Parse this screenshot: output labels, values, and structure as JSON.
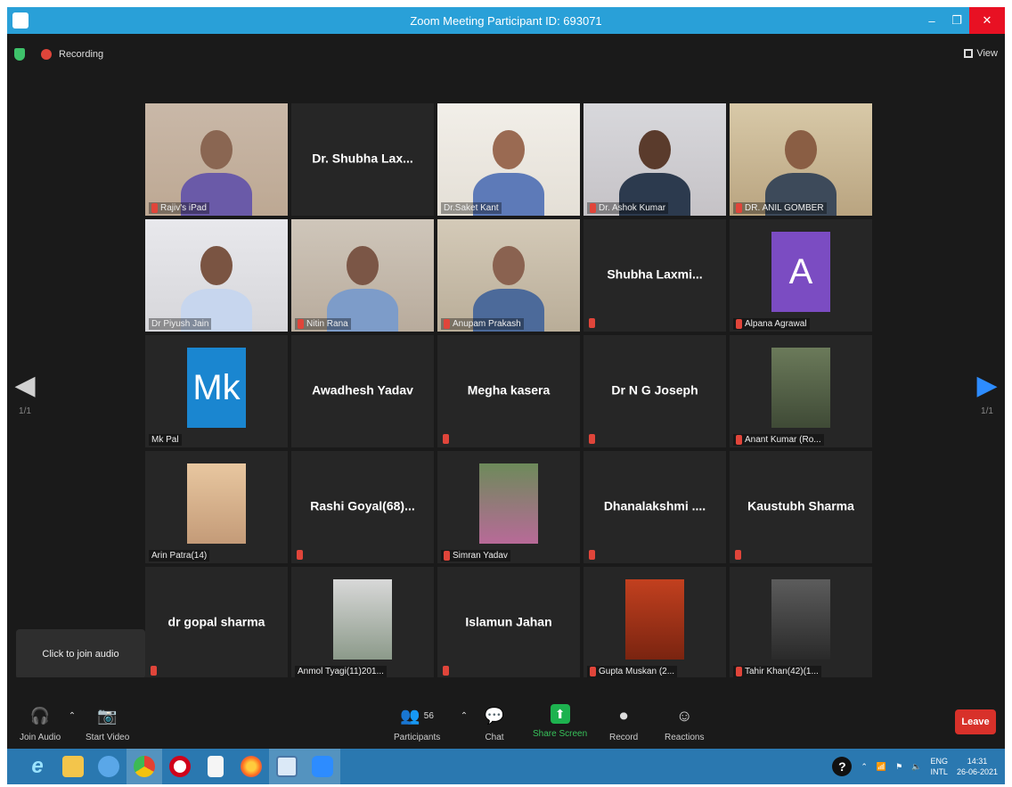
{
  "window": {
    "title": "Zoom Meeting Participant ID: 693071",
    "minimize": "–",
    "restore": "❐",
    "close": "✕"
  },
  "status": {
    "recording": "Recording",
    "view": "View"
  },
  "pager": {
    "left": "1/1",
    "right": "1/1"
  },
  "tiles": [
    {
      "name": "Rajiv's iPad",
      "type": "video",
      "muted": true,
      "active": false
    },
    {
      "name": "Dr. Shubha Lax...",
      "type": "name",
      "muted": false,
      "active": false
    },
    {
      "name": "Dr.Saket Kant",
      "type": "video",
      "muted": false,
      "active": false
    },
    {
      "name": "Dr. Ashok Kumar",
      "type": "video",
      "muted": true,
      "active": false
    },
    {
      "name": "DR. ANIL GOMBER",
      "type": "video",
      "muted": true,
      "active": false
    },
    {
      "name": "Dr Piyush Jain",
      "type": "video",
      "muted": false,
      "active": true
    },
    {
      "name": "Nitin Rana",
      "type": "video",
      "muted": true,
      "active": false
    },
    {
      "name": "Anupam Prakash",
      "type": "video",
      "muted": true,
      "active": false
    },
    {
      "name": "Shubha Laxmi...",
      "type": "name",
      "muted": true,
      "active": false
    },
    {
      "name": "Alpana Agrawal",
      "type": "avatar",
      "initials": "A",
      "avatar_color": "#7b4cc2",
      "muted": true,
      "active": false
    },
    {
      "name": "Mk Pal",
      "type": "avatar",
      "initials": "Mk",
      "avatar_color": "#1a86d0",
      "muted": false,
      "active": false
    },
    {
      "name": "Awadhesh Yadav",
      "type": "name",
      "muted": false,
      "active": false
    },
    {
      "name": "Megha kasera",
      "type": "name",
      "muted": true,
      "active": false
    },
    {
      "name": "Dr N G Joseph",
      "type": "name",
      "muted": true,
      "active": false
    },
    {
      "name": "Anant Kumar (Ro...",
      "type": "photo",
      "muted": true,
      "active": false
    },
    {
      "name": "Arin Patra(14)",
      "type": "blur",
      "muted": false,
      "active": false
    },
    {
      "name": "Rashi Goyal(68)...",
      "type": "name",
      "muted": true,
      "active": false
    },
    {
      "name": "Simran Yadav",
      "type": "photo",
      "muted": true,
      "active": false
    },
    {
      "name": "Dhanalakshmi ....",
      "type": "name",
      "muted": true,
      "active": false
    },
    {
      "name": "Kaustubh Sharma",
      "type": "name",
      "muted": true,
      "active": false
    },
    {
      "name": "dr gopal sharma",
      "type": "name",
      "muted": true,
      "active": false
    },
    {
      "name": "Anmol Tyagi(11)201...",
      "type": "photo",
      "muted": false,
      "active": false
    },
    {
      "name": "Islamun Jahan",
      "type": "name",
      "muted": true,
      "active": false
    },
    {
      "name": "Gupta Muskan (2...",
      "type": "photo",
      "muted": true,
      "active": false
    },
    {
      "name": "Tahir Khan(42)(1...",
      "type": "photo",
      "muted": true,
      "active": false
    }
  ],
  "popup": {
    "join_audio": "Click to join audio"
  },
  "toolbar": {
    "join_audio": "Join Audio",
    "start_video": "Start Video",
    "participants": "Participants",
    "participants_count": "56",
    "chat": "Chat",
    "share_screen": "Share Screen",
    "record": "Record",
    "reactions": "Reactions",
    "leave": "Leave"
  },
  "taskbar": {
    "icons": [
      "internet-explorer-icon",
      "file-explorer-icon",
      "app-rocket-icon",
      "chrome-icon",
      "opera-icon",
      "document-icon",
      "firefox-icon",
      "ebook-icon",
      "zoom-icon"
    ],
    "lang_top": "ENG",
    "lang_bottom": "INTL",
    "time": "14:31",
    "date": "26-06-2021"
  },
  "colors": {
    "titlebar": "#29a0d8",
    "leave": "#d8312a",
    "share": "#1db24f",
    "active_border": "#c8d62b",
    "taskbar": "#2a78b0"
  }
}
